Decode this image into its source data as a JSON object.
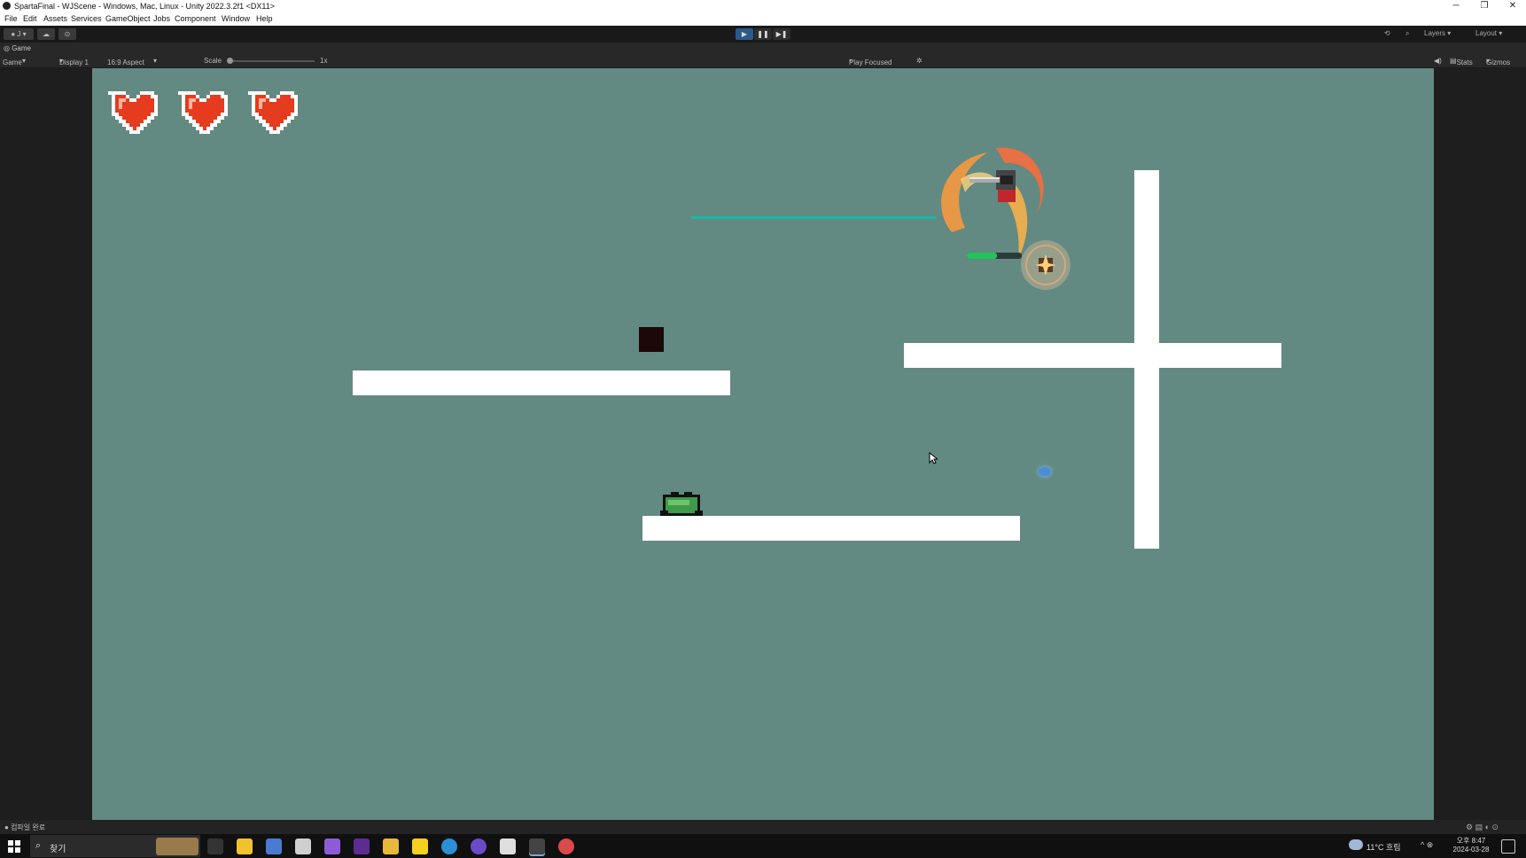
{
  "window": {
    "title": "SpartaFinal - WJScene - Windows, Mac, Linux - Unity 2022.3.2f1 <DX11>",
    "controls": [
      "─",
      "❐",
      "✕"
    ]
  },
  "menu": [
    "File",
    "Edit",
    "Assets",
    "Services",
    "GameObject",
    "Jobs",
    "Component",
    "Window",
    "Help"
  ],
  "toolbar": {
    "account_label": "J",
    "layers_label": "Layers",
    "layout_label": "Layout"
  },
  "game_tab": {
    "label": "Game"
  },
  "game_bar": {
    "mode": "Game",
    "display": "Display 1",
    "aspect": "16:9 Aspect",
    "scale_label": "Scale",
    "scale_value": "1x",
    "play_focused": "Play Focused",
    "stats": "Stats",
    "gizmos": "Gizmos"
  },
  "hud": {
    "hearts": 3,
    "heart_color": "#e53b1e"
  },
  "colors": {
    "game_background": "#628a82",
    "platform": "#ffffff",
    "laser": "#1fb5a5",
    "health_bar": "#22c45a"
  },
  "status_bar": {
    "text": "컴파일 완료"
  },
  "taskbar": {
    "search_placeholder": "찾기",
    "weather": "11°C 흐림",
    "time": "오후 8:47",
    "date": "2024-03-28"
  }
}
